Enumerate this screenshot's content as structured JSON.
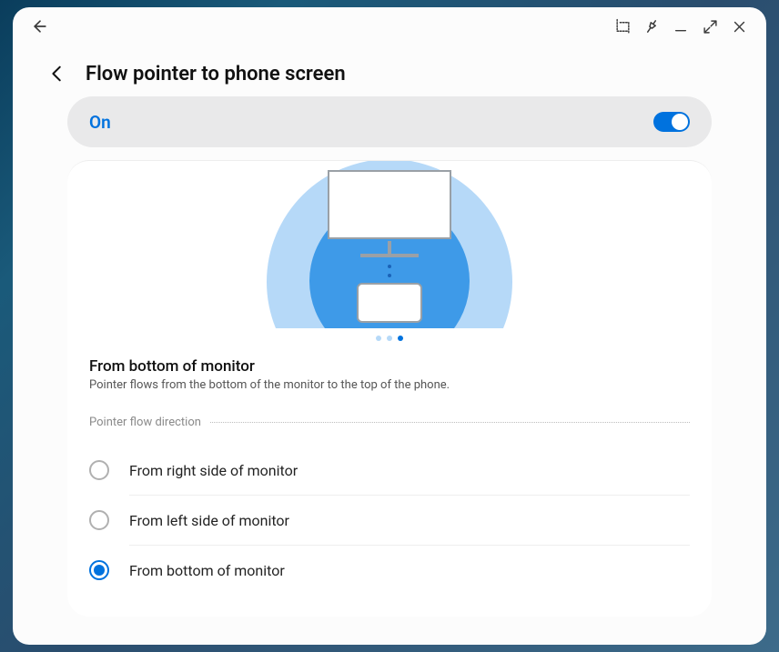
{
  "header": {
    "title": "Flow pointer to phone screen"
  },
  "toggle": {
    "label": "On",
    "state": true
  },
  "illustration": {
    "description_title": "From bottom of monitor",
    "description_sub": "Pointer flows from the bottom of the monitor to the top of the phone.",
    "pager_count": 3,
    "pager_active": 2
  },
  "section": {
    "label": "Pointer flow direction"
  },
  "options": [
    {
      "label": "From right side of monitor",
      "selected": false
    },
    {
      "label": "From left side of monitor",
      "selected": false
    },
    {
      "label": "From bottom of monitor",
      "selected": true
    }
  ]
}
